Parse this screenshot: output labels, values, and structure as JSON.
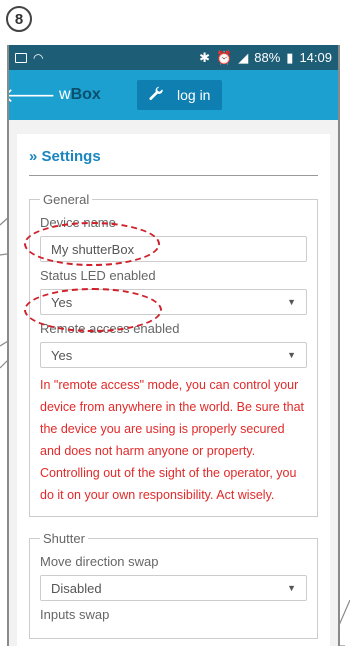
{
  "step_number": "8",
  "status_bar": {
    "percent": "88%",
    "time": "14:09"
  },
  "app": {
    "brand_w": "w",
    "brand_box": "Box",
    "login_label": "log in"
  },
  "settings": {
    "title": "» Settings",
    "general": {
      "legend": "General",
      "device_name_label": "Device name",
      "device_name_value": "My shutterBox",
      "status_led_label": "Status LED enabled",
      "status_led_value": "Yes",
      "remote_label": "Remote access enabled",
      "remote_value": "Yes",
      "warning": "In \"remote access\" mode, you can control your device from anywhere in the world. Be sure that the device you are using is properly secured and does not harm anyone or property. Controlling out of the sight of the operator, you do it on your own responsibility. Act wisely."
    },
    "shutter": {
      "legend": "Shutter",
      "move_dir_label": "Move direction swap",
      "move_dir_value": "Disabled",
      "inputs_swap_label": "Inputs swap"
    }
  },
  "icons": [
    "back-arrow-icon",
    "wrench-icon",
    "image-icon",
    "wifi-icon",
    "bluetooth-icon",
    "alarm-icon",
    "signal-icon",
    "battery-icon",
    "dropdown-arrow-icon"
  ],
  "colors": {
    "statusbar": "#1d5d76",
    "appbar": "#1ba0cf",
    "login": "#0e7fb0",
    "title": "#1a86be",
    "warning": "#e12a2a",
    "callout": "#d0202a"
  }
}
